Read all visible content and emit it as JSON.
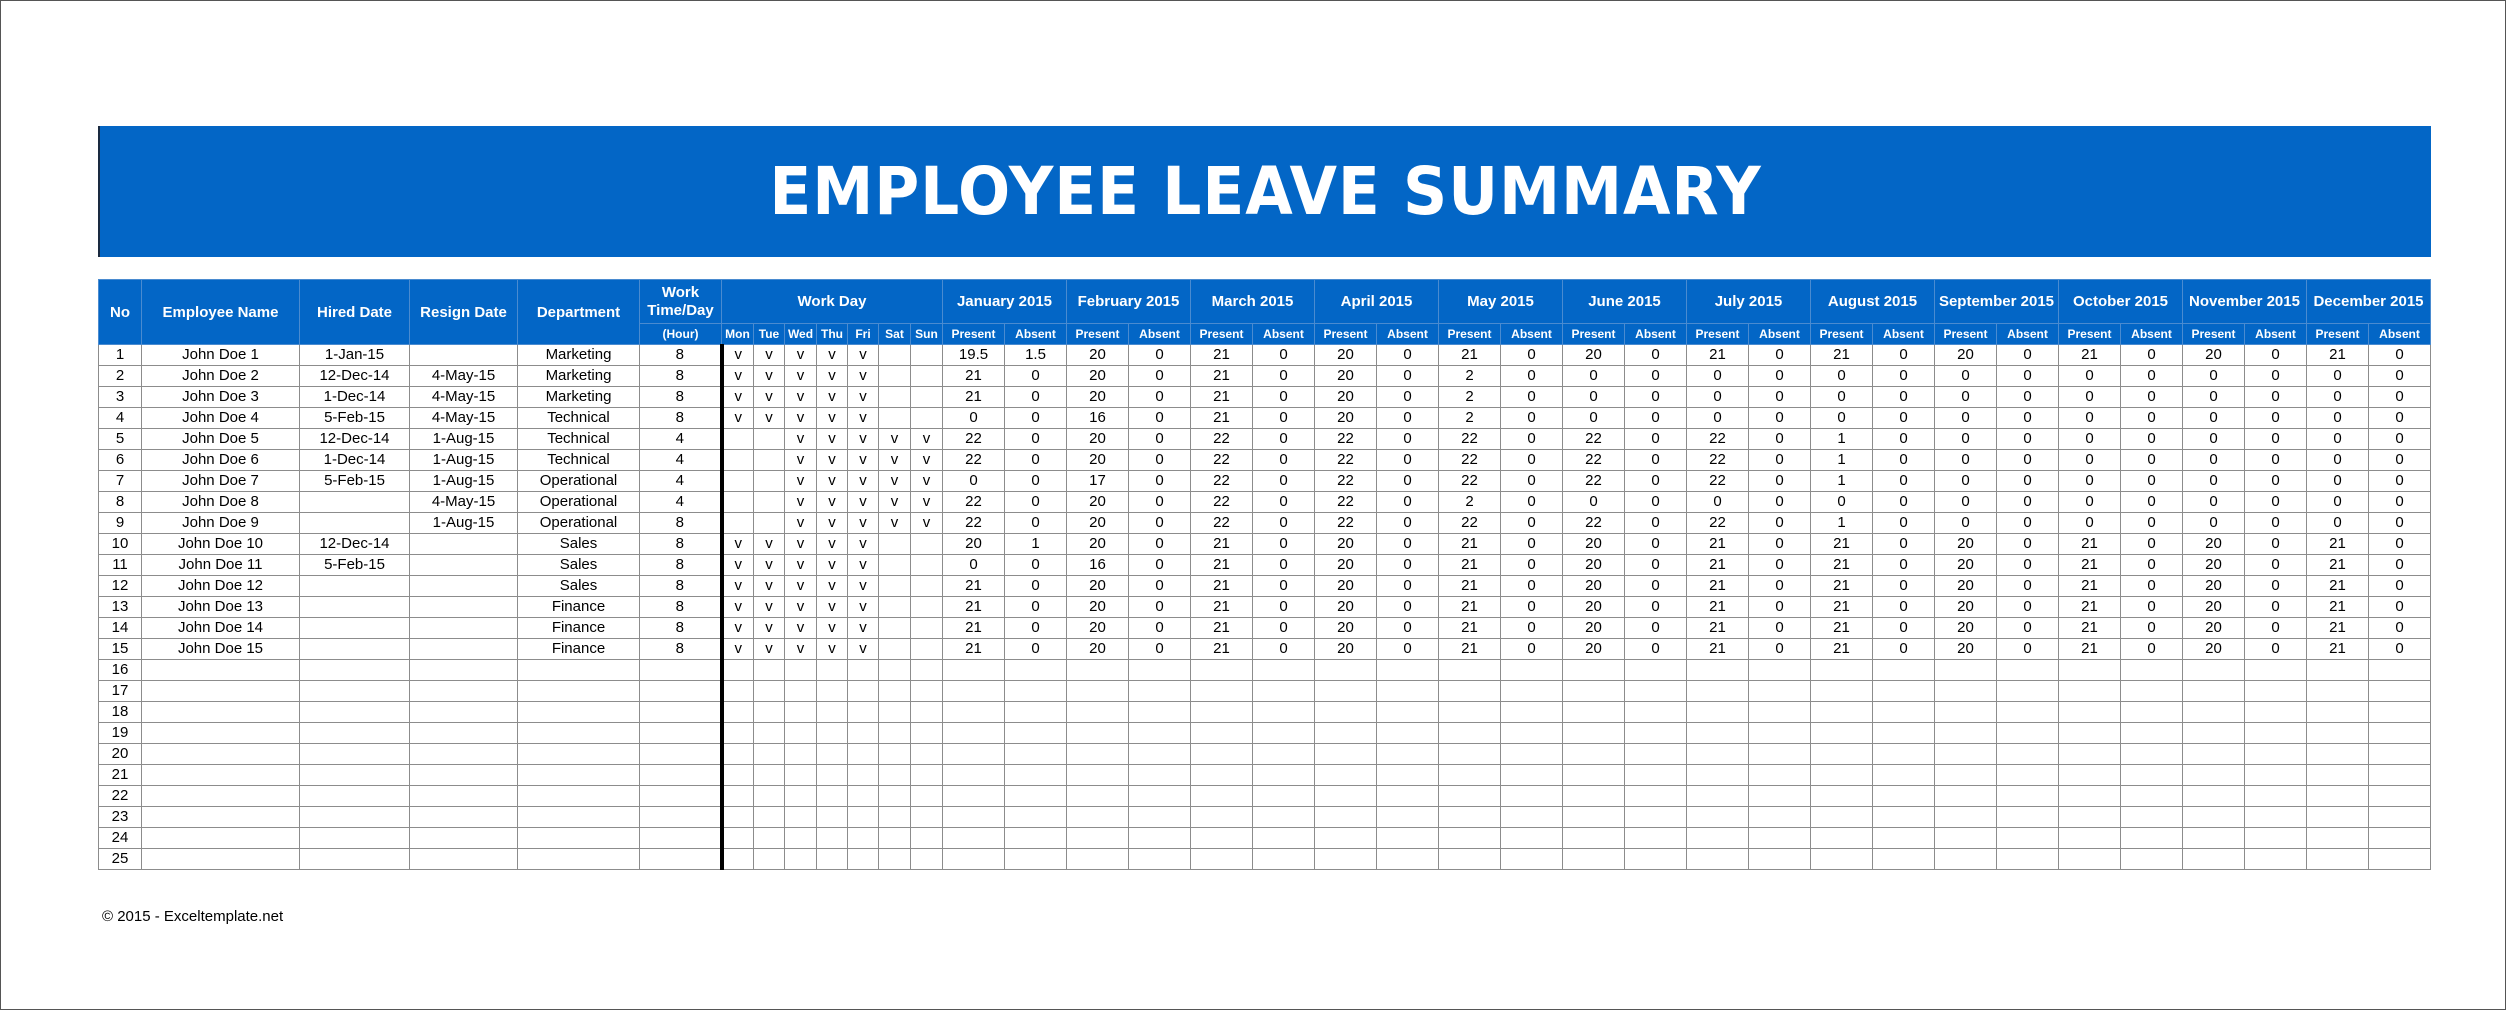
{
  "title": "EMPLOYEE LEAVE SUMMARY",
  "footer": "© 2015 - Exceltemplate.net",
  "colors": {
    "header_blue": "#0366c6",
    "grid_gray": "#8c8c8c"
  },
  "headers": {
    "no": "No",
    "name": "Employee Name",
    "hired": "Hired Date",
    "resign": "Resign Date",
    "dept": "Department",
    "work_time": "Work Time/Day",
    "work_time_unit": "(Hour)",
    "work_day": "Work Day",
    "days": [
      "Mon",
      "Tue",
      "Wed",
      "Thu",
      "Fri",
      "Sat",
      "Sun"
    ],
    "months": [
      "January 2015",
      "February 2015",
      "March 2015",
      "April 2015",
      "May 2015",
      "June 2015",
      "July 2015",
      "August 2015",
      "September 2015",
      "October 2015",
      "November 2015",
      "December 2015"
    ],
    "present": "Present",
    "absent": "Absent"
  },
  "rows": [
    {
      "no": "1",
      "name": "John Doe 1",
      "hired": "1-Jan-15",
      "resign": "",
      "dept": "Marketing",
      "hours": "8",
      "days": [
        "v",
        "v",
        "v",
        "v",
        "v",
        "",
        ""
      ],
      "months": [
        [
          "19.5",
          "1.5"
        ],
        [
          "20",
          "0"
        ],
        [
          "21",
          "0"
        ],
        [
          "20",
          "0"
        ],
        [
          "21",
          "0"
        ],
        [
          "20",
          "0"
        ],
        [
          "21",
          "0"
        ],
        [
          "21",
          "0"
        ],
        [
          "20",
          "0"
        ],
        [
          "21",
          "0"
        ],
        [
          "20",
          "0"
        ],
        [
          "21",
          "0"
        ]
      ]
    },
    {
      "no": "2",
      "name": "John Doe 2",
      "hired": "12-Dec-14",
      "resign": "4-May-15",
      "dept": "Marketing",
      "hours": "8",
      "days": [
        "v",
        "v",
        "v",
        "v",
        "v",
        "",
        ""
      ],
      "months": [
        [
          "21",
          "0"
        ],
        [
          "20",
          "0"
        ],
        [
          "21",
          "0"
        ],
        [
          "20",
          "0"
        ],
        [
          "2",
          "0"
        ],
        [
          "0",
          "0"
        ],
        [
          "0",
          "0"
        ],
        [
          "0",
          "0"
        ],
        [
          "0",
          "0"
        ],
        [
          "0",
          "0"
        ],
        [
          "0",
          "0"
        ],
        [
          "0",
          "0"
        ]
      ]
    },
    {
      "no": "3",
      "name": "John Doe 3",
      "hired": "1-Dec-14",
      "resign": "4-May-15",
      "dept": "Marketing",
      "hours": "8",
      "days": [
        "v",
        "v",
        "v",
        "v",
        "v",
        "",
        ""
      ],
      "months": [
        [
          "21",
          "0"
        ],
        [
          "20",
          "0"
        ],
        [
          "21",
          "0"
        ],
        [
          "20",
          "0"
        ],
        [
          "2",
          "0"
        ],
        [
          "0",
          "0"
        ],
        [
          "0",
          "0"
        ],
        [
          "0",
          "0"
        ],
        [
          "0",
          "0"
        ],
        [
          "0",
          "0"
        ],
        [
          "0",
          "0"
        ],
        [
          "0",
          "0"
        ]
      ]
    },
    {
      "no": "4",
      "name": "John Doe 4",
      "hired": "5-Feb-15",
      "resign": "4-May-15",
      "dept": "Technical",
      "hours": "8",
      "days": [
        "v",
        "v",
        "v",
        "v",
        "v",
        "",
        ""
      ],
      "months": [
        [
          "0",
          "0"
        ],
        [
          "16",
          "0"
        ],
        [
          "21",
          "0"
        ],
        [
          "20",
          "0"
        ],
        [
          "2",
          "0"
        ],
        [
          "0",
          "0"
        ],
        [
          "0",
          "0"
        ],
        [
          "0",
          "0"
        ],
        [
          "0",
          "0"
        ],
        [
          "0",
          "0"
        ],
        [
          "0",
          "0"
        ],
        [
          "0",
          "0"
        ]
      ]
    },
    {
      "no": "5",
      "name": "John Doe 5",
      "hired": "12-Dec-14",
      "resign": "1-Aug-15",
      "dept": "Technical",
      "hours": "4",
      "days": [
        "",
        "",
        "v",
        "v",
        "v",
        "v",
        "v"
      ],
      "months": [
        [
          "22",
          "0"
        ],
        [
          "20",
          "0"
        ],
        [
          "22",
          "0"
        ],
        [
          "22",
          "0"
        ],
        [
          "22",
          "0"
        ],
        [
          "22",
          "0"
        ],
        [
          "22",
          "0"
        ],
        [
          "1",
          "0"
        ],
        [
          "0",
          "0"
        ],
        [
          "0",
          "0"
        ],
        [
          "0",
          "0"
        ],
        [
          "0",
          "0"
        ]
      ]
    },
    {
      "no": "6",
      "name": "John Doe 6",
      "hired": "1-Dec-14",
      "resign": "1-Aug-15",
      "dept": "Technical",
      "hours": "4",
      "days": [
        "",
        "",
        "v",
        "v",
        "v",
        "v",
        "v"
      ],
      "months": [
        [
          "22",
          "0"
        ],
        [
          "20",
          "0"
        ],
        [
          "22",
          "0"
        ],
        [
          "22",
          "0"
        ],
        [
          "22",
          "0"
        ],
        [
          "22",
          "0"
        ],
        [
          "22",
          "0"
        ],
        [
          "1",
          "0"
        ],
        [
          "0",
          "0"
        ],
        [
          "0",
          "0"
        ],
        [
          "0",
          "0"
        ],
        [
          "0",
          "0"
        ]
      ]
    },
    {
      "no": "7",
      "name": "John Doe 7",
      "hired": "5-Feb-15",
      "resign": "1-Aug-15",
      "dept": "Operational",
      "hours": "4",
      "days": [
        "",
        "",
        "v",
        "v",
        "v",
        "v",
        "v"
      ],
      "months": [
        [
          "0",
          "0"
        ],
        [
          "17",
          "0"
        ],
        [
          "22",
          "0"
        ],
        [
          "22",
          "0"
        ],
        [
          "22",
          "0"
        ],
        [
          "22",
          "0"
        ],
        [
          "22",
          "0"
        ],
        [
          "1",
          "0"
        ],
        [
          "0",
          "0"
        ],
        [
          "0",
          "0"
        ],
        [
          "0",
          "0"
        ],
        [
          "0",
          "0"
        ]
      ]
    },
    {
      "no": "8",
      "name": "John Doe 8",
      "hired": "",
      "resign": "4-May-15",
      "dept": "Operational",
      "hours": "4",
      "days": [
        "",
        "",
        "v",
        "v",
        "v",
        "v",
        "v"
      ],
      "months": [
        [
          "22",
          "0"
        ],
        [
          "20",
          "0"
        ],
        [
          "22",
          "0"
        ],
        [
          "22",
          "0"
        ],
        [
          "2",
          "0"
        ],
        [
          "0",
          "0"
        ],
        [
          "0",
          "0"
        ],
        [
          "0",
          "0"
        ],
        [
          "0",
          "0"
        ],
        [
          "0",
          "0"
        ],
        [
          "0",
          "0"
        ],
        [
          "0",
          "0"
        ]
      ]
    },
    {
      "no": "9",
      "name": "John Doe 9",
      "hired": "",
      "resign": "1-Aug-15",
      "dept": "Operational",
      "hours": "8",
      "days": [
        "",
        "",
        "v",
        "v",
        "v",
        "v",
        "v"
      ],
      "months": [
        [
          "22",
          "0"
        ],
        [
          "20",
          "0"
        ],
        [
          "22",
          "0"
        ],
        [
          "22",
          "0"
        ],
        [
          "22",
          "0"
        ],
        [
          "22",
          "0"
        ],
        [
          "22",
          "0"
        ],
        [
          "1",
          "0"
        ],
        [
          "0",
          "0"
        ],
        [
          "0",
          "0"
        ],
        [
          "0",
          "0"
        ],
        [
          "0",
          "0"
        ]
      ]
    },
    {
      "no": "10",
      "name": "John Doe 10",
      "hired": "12-Dec-14",
      "resign": "",
      "dept": "Sales",
      "hours": "8",
      "days": [
        "v",
        "v",
        "v",
        "v",
        "v",
        "",
        ""
      ],
      "months": [
        [
          "20",
          "1"
        ],
        [
          "20",
          "0"
        ],
        [
          "21",
          "0"
        ],
        [
          "20",
          "0"
        ],
        [
          "21",
          "0"
        ],
        [
          "20",
          "0"
        ],
        [
          "21",
          "0"
        ],
        [
          "21",
          "0"
        ],
        [
          "20",
          "0"
        ],
        [
          "21",
          "0"
        ],
        [
          "20",
          "0"
        ],
        [
          "21",
          "0"
        ]
      ]
    },
    {
      "no": "11",
      "name": "John Doe 11",
      "hired": "5-Feb-15",
      "resign": "",
      "dept": "Sales",
      "hours": "8",
      "days": [
        "v",
        "v",
        "v",
        "v",
        "v",
        "",
        ""
      ],
      "months": [
        [
          "0",
          "0"
        ],
        [
          "16",
          "0"
        ],
        [
          "21",
          "0"
        ],
        [
          "20",
          "0"
        ],
        [
          "21",
          "0"
        ],
        [
          "20",
          "0"
        ],
        [
          "21",
          "0"
        ],
        [
          "21",
          "0"
        ],
        [
          "20",
          "0"
        ],
        [
          "21",
          "0"
        ],
        [
          "20",
          "0"
        ],
        [
          "21",
          "0"
        ]
      ]
    },
    {
      "no": "12",
      "name": "John Doe 12",
      "hired": "",
      "resign": "",
      "dept": "Sales",
      "hours": "8",
      "days": [
        "v",
        "v",
        "v",
        "v",
        "v",
        "",
        ""
      ],
      "months": [
        [
          "21",
          "0"
        ],
        [
          "20",
          "0"
        ],
        [
          "21",
          "0"
        ],
        [
          "20",
          "0"
        ],
        [
          "21",
          "0"
        ],
        [
          "20",
          "0"
        ],
        [
          "21",
          "0"
        ],
        [
          "21",
          "0"
        ],
        [
          "20",
          "0"
        ],
        [
          "21",
          "0"
        ],
        [
          "20",
          "0"
        ],
        [
          "21",
          "0"
        ]
      ]
    },
    {
      "no": "13",
      "name": "John Doe 13",
      "hired": "",
      "resign": "",
      "dept": "Finance",
      "hours": "8",
      "days": [
        "v",
        "v",
        "v",
        "v",
        "v",
        "",
        ""
      ],
      "months": [
        [
          "21",
          "0"
        ],
        [
          "20",
          "0"
        ],
        [
          "21",
          "0"
        ],
        [
          "20",
          "0"
        ],
        [
          "21",
          "0"
        ],
        [
          "20",
          "0"
        ],
        [
          "21",
          "0"
        ],
        [
          "21",
          "0"
        ],
        [
          "20",
          "0"
        ],
        [
          "21",
          "0"
        ],
        [
          "20",
          "0"
        ],
        [
          "21",
          "0"
        ]
      ]
    },
    {
      "no": "14",
      "name": "John Doe 14",
      "hired": "",
      "resign": "",
      "dept": "Finance",
      "hours": "8",
      "days": [
        "v",
        "v",
        "v",
        "v",
        "v",
        "",
        ""
      ],
      "months": [
        [
          "21",
          "0"
        ],
        [
          "20",
          "0"
        ],
        [
          "21",
          "0"
        ],
        [
          "20",
          "0"
        ],
        [
          "21",
          "0"
        ],
        [
          "20",
          "0"
        ],
        [
          "21",
          "0"
        ],
        [
          "21",
          "0"
        ],
        [
          "20",
          "0"
        ],
        [
          "21",
          "0"
        ],
        [
          "20",
          "0"
        ],
        [
          "21",
          "0"
        ]
      ]
    },
    {
      "no": "15",
      "name": "John Doe 15",
      "hired": "",
      "resign": "",
      "dept": "Finance",
      "hours": "8",
      "days": [
        "v",
        "v",
        "v",
        "v",
        "v",
        "",
        ""
      ],
      "months": [
        [
          "21",
          "0"
        ],
        [
          "20",
          "0"
        ],
        [
          "21",
          "0"
        ],
        [
          "20",
          "0"
        ],
        [
          "21",
          "0"
        ],
        [
          "20",
          "0"
        ],
        [
          "21",
          "0"
        ],
        [
          "21",
          "0"
        ],
        [
          "20",
          "0"
        ],
        [
          "21",
          "0"
        ],
        [
          "20",
          "0"
        ],
        [
          "21",
          "0"
        ]
      ]
    }
  ],
  "empty_row_numbers": [
    "16",
    "17",
    "18",
    "19",
    "20",
    "21",
    "22",
    "23",
    "24",
    "25"
  ]
}
